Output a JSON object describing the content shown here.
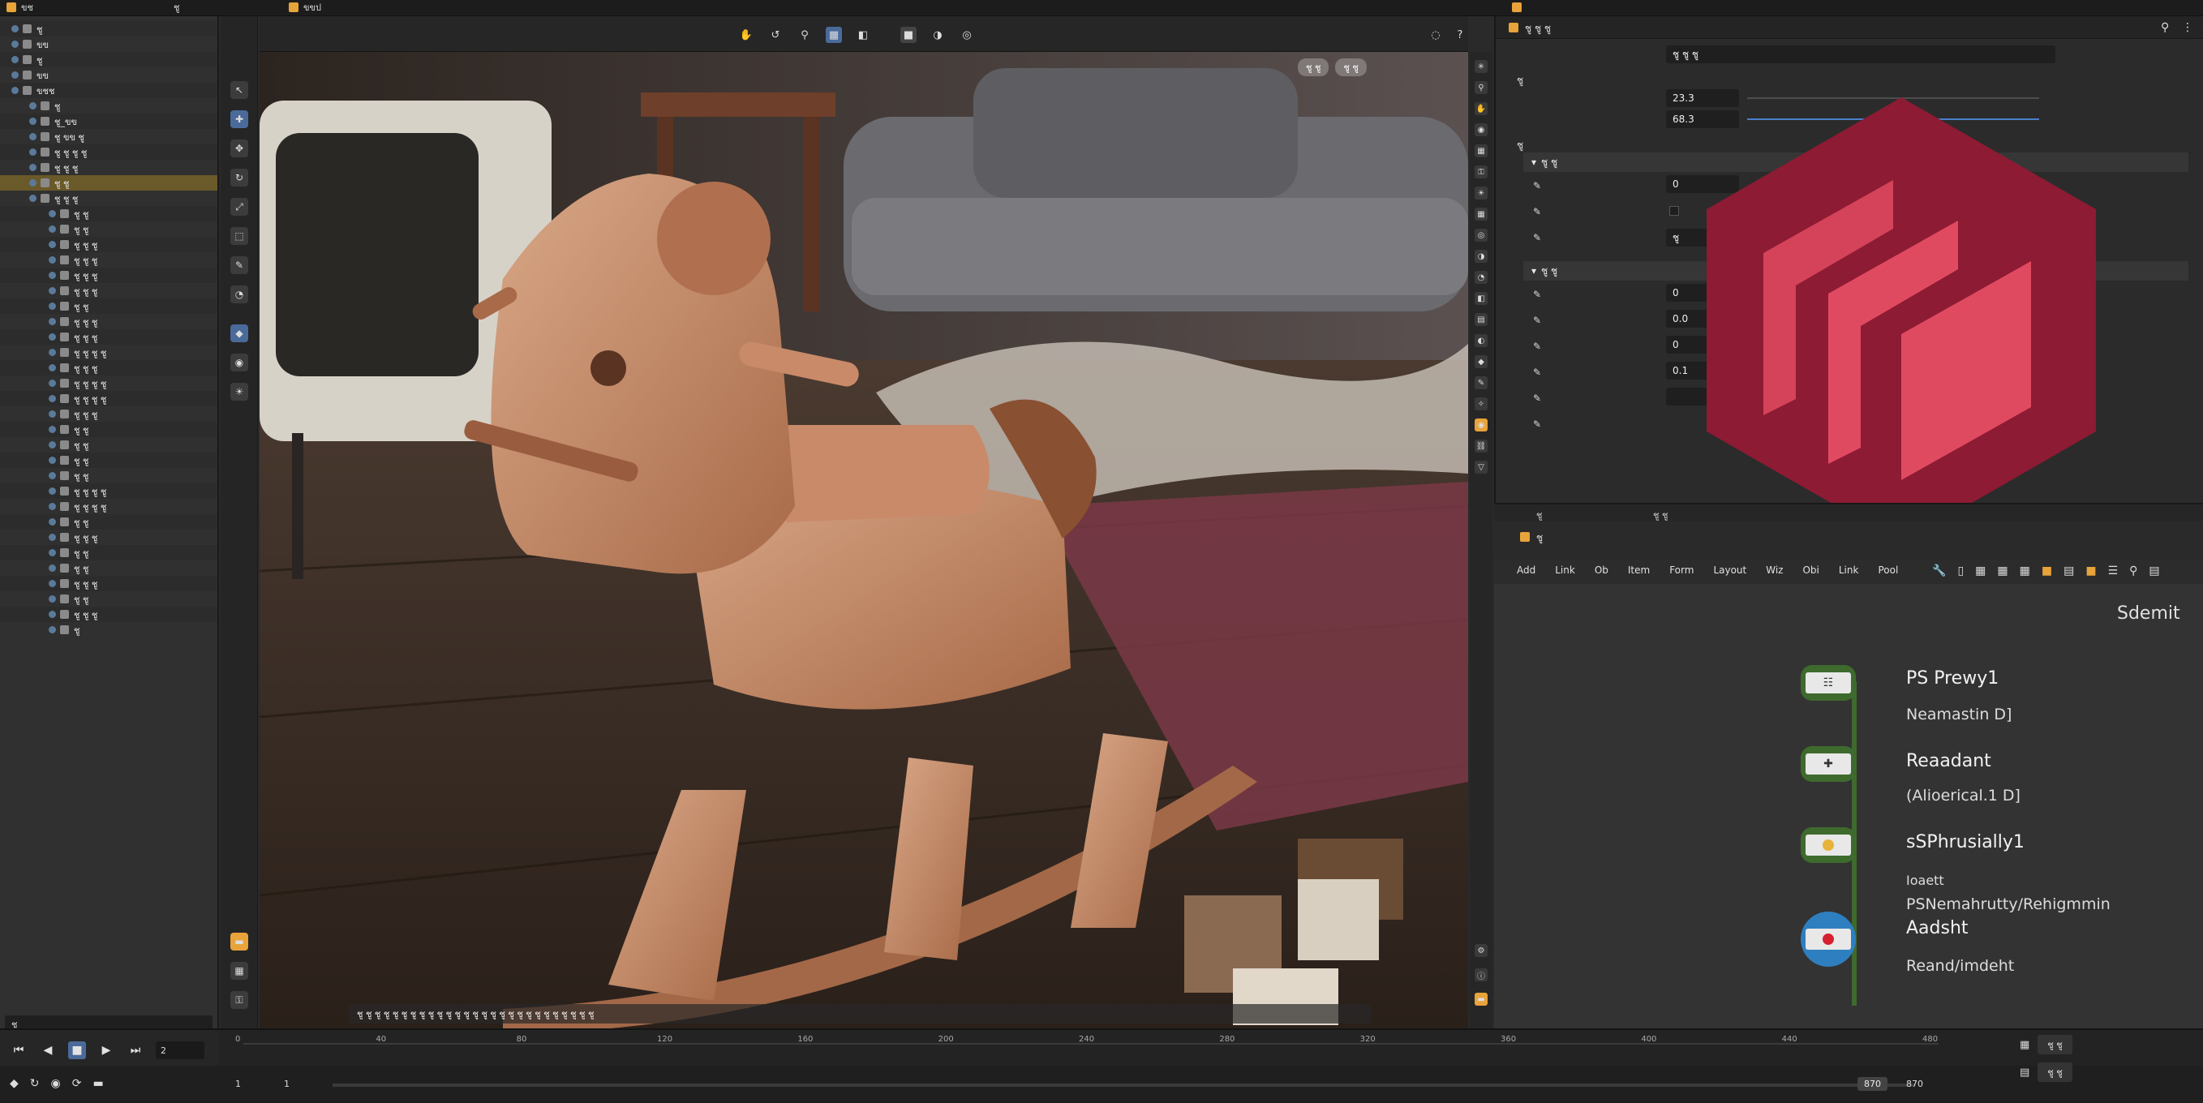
{
  "topbar": {
    "item1": "ขช",
    "item2": "ชู",
    "item3": "ขขป"
  },
  "outliner": {
    "rows": [
      "ชู",
      "ขข",
      "ชู",
      "ขข",
      "ขชช",
      "ชู",
      "ชู_ขข",
      "ชู ขข ชู",
      "ชู ชู ชู ชู",
      "ชู ชู ชู",
      "ชู ชู",
      "ชู ชู ชู",
      "ชู ชู",
      "ชู ชู",
      "ชู ชู ชู",
      "ชู ชู ชู",
      "ชู ชู ชู",
      "ชู ชู ชู",
      "ชู ชู",
      "ชู ชู ชู",
      "ชู ชู ชู",
      "ชู ชู ชู ชู",
      "ชู ชู ชู",
      "ชู ชู ชู ชู",
      "ชู ชู ชู ชู",
      "ชู ชู ชู",
      "ชู ชู",
      "ชู ชู",
      "ชู ชู",
      "ชู ชู",
      "ชู ชู ชู ชู",
      "ชู ชู ชู ชู",
      "ชู ชู",
      "ชู ชู ชู",
      "ชู ชู",
      "ชู ชู",
      "ชู ชู ชู",
      "ชู ชู",
      "ชู ชู ชู",
      "ชู"
    ],
    "filter_label": "ชู"
  },
  "viewport": {
    "overlay_right1": "ชู ชู",
    "overlay_right2": "ชู ชู",
    "status": "ชู ชู ชู ชู ชู ชู ชู ชู ชู ชู ชู ชู ชู ชู ชู ชู ชู ชู ชู ชู ชู ชู ชู ชู ชู ชู ชู"
  },
  "properties": {
    "title": "ชู ชู ชู",
    "field0": "ชู ชู ชู",
    "group1": "ชู",
    "row_a_value": "23.3",
    "row_b_value": "68.3",
    "group2": "ชู",
    "sub1": "ชู ชู",
    "p1_value": "0",
    "p3_value": "ชู",
    "sub2": "ชู ชู",
    "q1_value": "0",
    "q2_value": "0.0",
    "q3_value": "0",
    "q4_value": "0.1"
  },
  "nodes": {
    "head_tab1": "ชู",
    "head_tab2": "ชู ชู",
    "toolbar_label": "ชู",
    "menu": [
      "Add",
      "Link",
      "Ob",
      "Item",
      "Form",
      "Layout",
      "Wiz",
      "Obi",
      "Link",
      "Pool"
    ],
    "heading": "Sdemit",
    "n1_label": "PS Prewy1",
    "n1_sub": "Neamastin D]",
    "n2_label": "Reaadant",
    "n2_sub": "(Alioerical.1 D]",
    "n3_label": "sSPhrusially1",
    "n3_sub": "Ioaett",
    "n3_sub2": "PSNemahrutty/Rehigmmin",
    "n4_label": "Aadsht",
    "n4_sub": "Reand/imdeht"
  },
  "timeline": {
    "frame_field": "2",
    "start": "1",
    "end": "1",
    "ticks": [
      "0",
      "40",
      "80",
      "120",
      "160",
      "200",
      "240",
      "280",
      "320",
      "360",
      "400",
      "440",
      "480"
    ],
    "current": "870",
    "total": "870",
    "right1": "ชู ชู",
    "right2": "ชู ชู"
  },
  "colors": {
    "brand_dark": "#8d1b33",
    "brand_light": "#e04a60",
    "node_green": "#3f6a2e",
    "node_blue": "#2e7fbf",
    "accent_orange": "#e8a33a"
  }
}
